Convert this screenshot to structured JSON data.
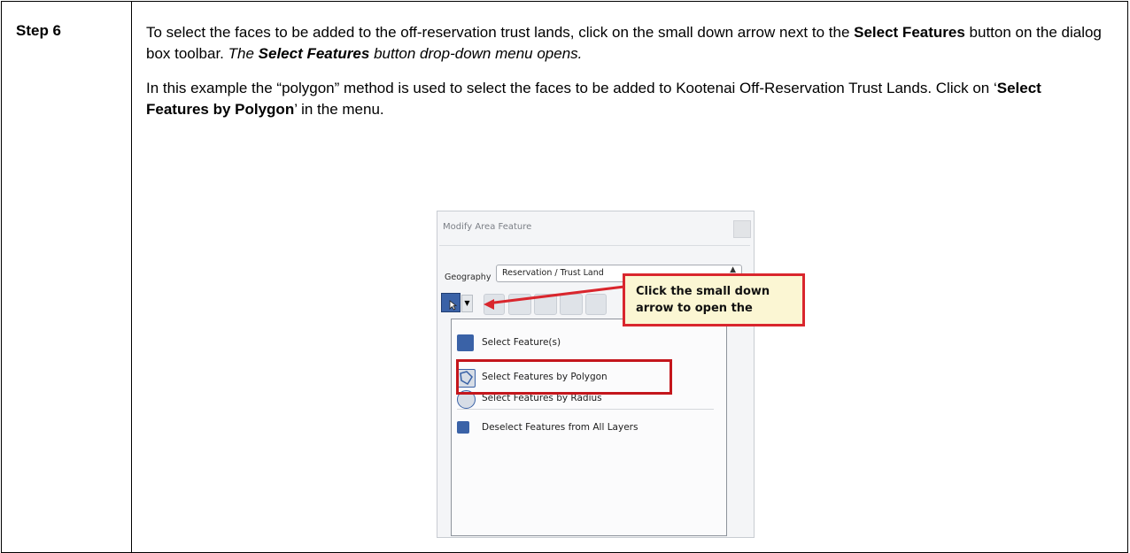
{
  "step": {
    "label": "Step 6"
  },
  "paragraph1": {
    "t1": "To select the faces to be added to the off-reservation trust lands, click on the small down arrow next to the ",
    "b1": "Select Features",
    "t2": " button on the dialog box toolbar. ",
    "i1": "The ",
    "bi1": "Select Features",
    "i2": " button drop-down menu opens."
  },
  "paragraph2": {
    "t1": "In this example the “polygon” method is used to select the faces to be added to Kootenai Off-Reservation Trust Lands. Click on ‘",
    "b1": "Select Features by Polygon",
    "t2": "’ in the menu."
  },
  "screenshot": {
    "title": "Modify Area Feature",
    "geography_label": "Geography",
    "geography_value": "Reservation / Trust Land",
    "callout_text": "Click the small down arrow to open the",
    "menu_items": [
      {
        "label": "Select Feature(s)",
        "icon": "select-feature-icon"
      },
      {
        "label": "Select Features by Polygon",
        "icon": "polygon-select-icon"
      },
      {
        "label": "Select Features by Radius",
        "icon": "radius-select-icon"
      },
      {
        "label": "Deselect Features from All Layers",
        "icon": "deselect-icon"
      }
    ]
  },
  "colors": {
    "callout_border": "#d9262d",
    "callout_fill": "#fbf6d3",
    "icon_blue": "#3a62a7"
  }
}
